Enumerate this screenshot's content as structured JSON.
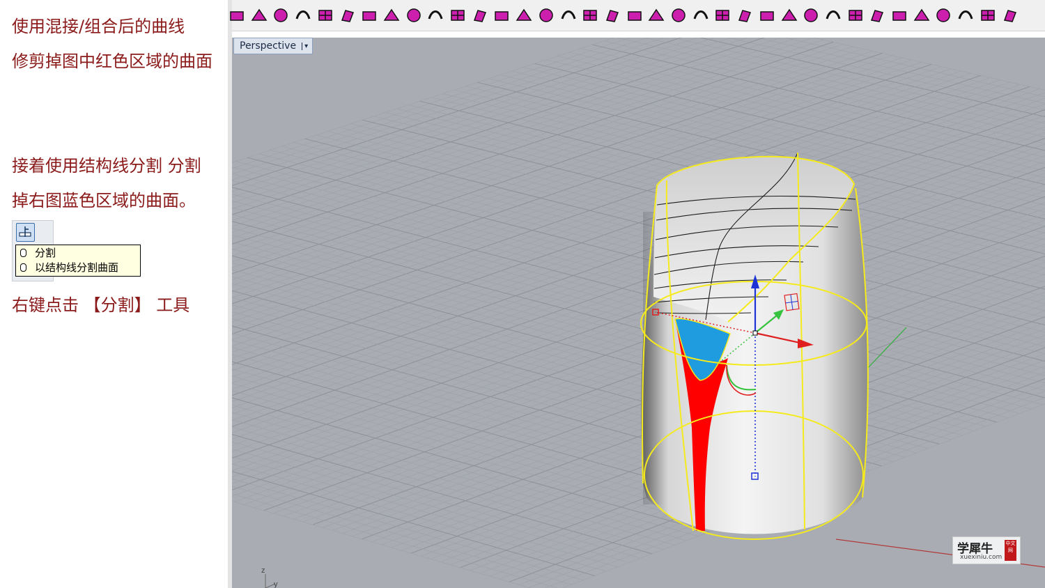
{
  "instructions": {
    "line1": "使用混接/组合后的曲线",
    "line2": "修剪掉图中红色区域的曲面",
    "line3": "接着使用结构线分割 分割",
    "line4": "掉右图蓝色区域的曲面。",
    "line5": "右键点击 【分割】 工具"
  },
  "tooltip": {
    "left_click": "分割",
    "right_click": "以结构线分割曲面"
  },
  "viewport": {
    "name": "Perspective",
    "dropdown_arrow": "▾",
    "axis_z": "z",
    "axis_y": "y"
  },
  "watermark": {
    "chinese": "学犀牛",
    "url": "xuexiniu.com",
    "seal": "中文网"
  },
  "toolbar_icons": [
    "rebuild-icon",
    "control-points-icon",
    "box-edit-icon",
    "curve-tool-icon",
    "blend-surface-icon",
    "sweep-icon",
    "extrude-icon",
    "arch-surface-icon",
    "fillet-icon",
    "offset-icon",
    "cap-icon",
    "solid-box-icon",
    "chamfer-icon",
    "move-points-icon",
    "check-surface-icon",
    "grid-surface-icon",
    "split-surface-icon",
    "delete-points-icon",
    "rail-revolve-icon",
    "network-surface-icon",
    "flow-icon",
    "twist-icon",
    "bend-icon",
    "point-grid-icon",
    "project-icon",
    "gumball-icon",
    "explode-icon",
    "branch-icon",
    "flip-icon",
    "orient-icon",
    "set-pivot-icon",
    "polyhedron-icon",
    "comb-icon",
    "unroll-icon",
    "patch-icon",
    "analyze-icon"
  ],
  "colors": {
    "instruction_text": "#8b1a1a",
    "toolbar_icon_fill": "#cc1fae",
    "viewport_bg": "#a9adb3",
    "surface_edge": "#f5ea1c",
    "trim_region": "#ff0000",
    "split_region": "#1f9bdf",
    "gumball_z": "#1e33d6",
    "gumball_x": "#e02020",
    "gumball_y": "#35c23c"
  }
}
